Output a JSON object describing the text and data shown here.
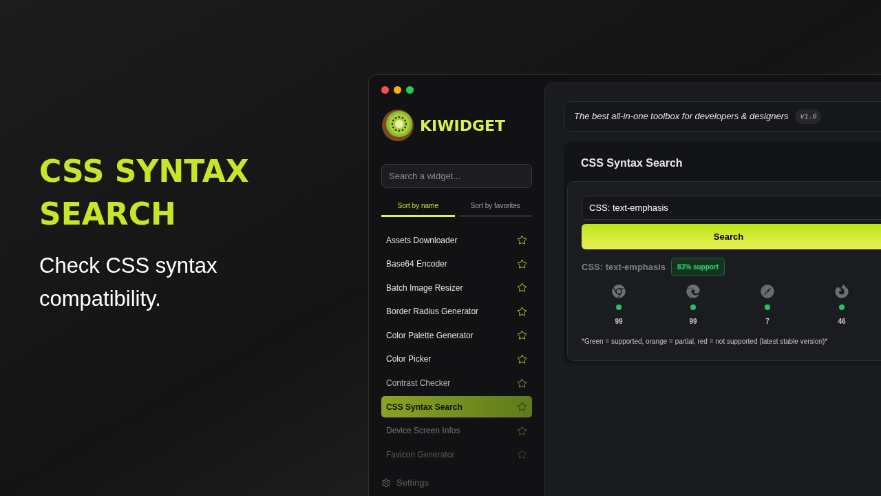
{
  "hero": {
    "title": "CSS SYNTAX SEARCH",
    "subtitle": "Check CSS syntax compatibility."
  },
  "sidebar": {
    "brand": "KIWIDGET",
    "search": {
      "placeholder": "Search a widget..."
    },
    "tabs": [
      {
        "label": "Sort by name",
        "selected": true
      },
      {
        "label": "Sort by favorites",
        "selected": false
      }
    ],
    "items": [
      {
        "label": "Assets Downloader",
        "selected": false
      },
      {
        "label": "Base64 Encoder",
        "selected": false
      },
      {
        "label": "Batch Image Resizer",
        "selected": false
      },
      {
        "label": "Border Radius Generator",
        "selected": false
      },
      {
        "label": "Color Palette Generator",
        "selected": false
      },
      {
        "label": "Color Picker",
        "selected": false
      },
      {
        "label": "Contrast Checker",
        "selected": false
      },
      {
        "label": "CSS Syntax Search",
        "selected": true
      },
      {
        "label": "Device Screen Infos",
        "selected": false
      },
      {
        "label": "Favicon Generator",
        "selected": false
      }
    ],
    "settings": "Settings"
  },
  "header": {
    "tagline": "The best all-in-one toolbox for developers & designers",
    "version": "v1.0"
  },
  "tool": {
    "title": "CSS Syntax Search",
    "query": "CSS: text-emphasis",
    "button": "Search",
    "result": "CSS: text-emphasis",
    "support": "83% support",
    "browsers": [
      {
        "version": "99",
        "color": "#22c55e"
      },
      {
        "version": "99",
        "color": "#22c55e"
      },
      {
        "version": "7",
        "color": "#22c55e"
      },
      {
        "version": "46",
        "color": "#22c55e"
      }
    ],
    "note": "*Green = supported, orange = partial, red = not supported (latest stable version)*"
  }
}
